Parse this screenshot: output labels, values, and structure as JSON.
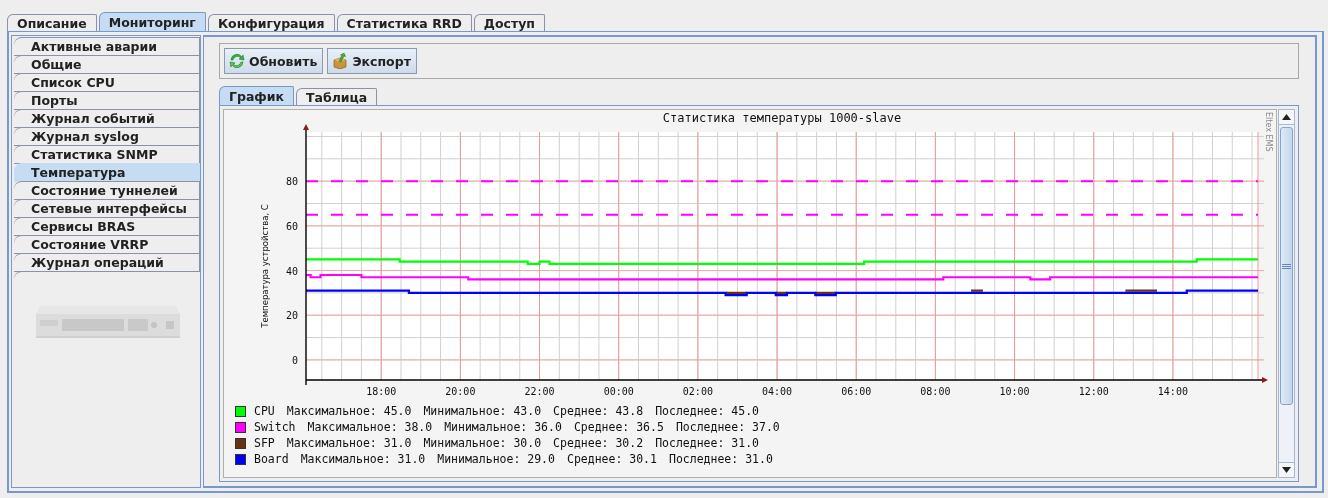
{
  "main_tabs": [
    {
      "label": "Описание",
      "selected": false
    },
    {
      "label": "Мониторинг",
      "selected": true
    },
    {
      "label": "Конфигурация",
      "selected": false
    },
    {
      "label": "Статистика RRD",
      "selected": false
    },
    {
      "label": "Доступ",
      "selected": false
    }
  ],
  "sidebar": {
    "items": [
      {
        "label": "Активные аварии",
        "selected": false
      },
      {
        "label": "Общие",
        "selected": false
      },
      {
        "label": "Список CPU",
        "selected": false
      },
      {
        "label": "Порты",
        "selected": false
      },
      {
        "label": "Журнал событий",
        "selected": false
      },
      {
        "label": "Журнал syslog",
        "selected": false
      },
      {
        "label": "Статистика SNMP",
        "selected": false
      },
      {
        "label": "Температура",
        "selected": true
      },
      {
        "label": "Состояние туннелей",
        "selected": false
      },
      {
        "label": "Сетевые интерфейсы",
        "selected": false
      },
      {
        "label": "Сервисы BRAS",
        "selected": false
      },
      {
        "label": "Состояние VRRP",
        "selected": false
      },
      {
        "label": "Журнал операций",
        "selected": false
      }
    ]
  },
  "toolbar": {
    "buttons": [
      {
        "label": "Обновить",
        "kind": "refresh"
      },
      {
        "label": "Экспорт",
        "kind": "export"
      }
    ]
  },
  "view_tabs": [
    {
      "label": "График",
      "selected": true
    },
    {
      "label": "Таблица",
      "selected": false
    }
  ],
  "chart": {
    "side_text": "Eltex EMS",
    "chart_data": {
      "type": "line",
      "title": "Статистика температуры 1000-slave",
      "ylabel": "Температура устройства, С",
      "grid": true,
      "x": [
        "2000-01-01T16:06",
        "2000-01-01T16:13",
        "2000-01-01T16:13",
        "2000-01-01T16:28",
        "2000-01-01T16:28",
        "2000-01-01T17:30",
        "2000-01-01T17:30",
        "2000-01-01T18:28",
        "2000-01-01T18:28",
        "2000-01-01T18:42",
        "2000-01-01T18:42",
        "2000-01-01T20:12",
        "2000-01-01T20:12",
        "2000-01-01T21:42",
        "2000-01-01T21:42",
        "2000-01-01T22:00",
        "2000-01-01T22:00",
        "2000-01-01T22:15",
        "2000-01-01T22:15",
        "2000-01-02T02:42",
        "2000-01-02T02:42",
        "2000-01-02T03:14",
        "2000-01-02T03:14",
        "2000-01-02T03:58",
        "2000-01-02T03:58",
        "2000-01-02T04:15",
        "2000-01-02T04:15",
        "2000-01-02T04:58",
        "2000-01-02T04:58",
        "2000-01-02T05:29",
        "2000-01-02T05:29",
        "2000-01-02T06:12",
        "2000-01-02T06:12",
        "2000-01-02T08:12",
        "2000-01-02T08:12",
        "2000-01-02T08:54",
        "2000-01-02T08:54",
        "2000-01-02T09:12",
        "2000-01-02T09:12",
        "2000-01-02T10:24",
        "2000-01-02T10:24",
        "2000-01-02T10:54",
        "2000-01-02T10:54",
        "2000-01-02T12:48",
        "2000-01-02T12:48",
        "2000-01-02T13:36",
        "2000-01-02T13:36",
        "2000-01-02T14:21",
        "2000-01-02T14:21",
        "2000-01-02T14:36",
        "2000-01-02T14:36",
        "2000-01-02T16:09"
      ],
      "xlim": [
        "2000-01-01T16:06",
        "2000-01-02T16:09"
      ],
      "ylim": [
        -9,
        102
      ],
      "xticks": [
        {
          "value": "2000-01-01T18:00",
          "label": "18:00"
        },
        {
          "value": "2000-01-01T20:00",
          "label": "20:00"
        },
        {
          "value": "2000-01-01T22:00",
          "label": "22:00"
        },
        {
          "value": "2000-01-02T00:00",
          "label": "00:00"
        },
        {
          "value": "2000-01-02T02:00",
          "label": "02:00"
        },
        {
          "value": "2000-01-02T04:00",
          "label": "04:00"
        },
        {
          "value": "2000-01-02T06:00",
          "label": "06:00"
        },
        {
          "value": "2000-01-02T08:00",
          "label": "08:00"
        },
        {
          "value": "2000-01-02T10:00",
          "label": "10:00"
        },
        {
          "value": "2000-01-02T12:00",
          "label": "12:00"
        },
        {
          "value": "2000-01-02T14:00",
          "label": "14:00"
        }
      ],
      "yticks": [
        0,
        20,
        40,
        60,
        80
      ],
      "ref_lines": [
        {
          "axis": "y",
          "value": 80,
          "color": "#ff00ff"
        },
        {
          "axis": "y",
          "value": 65,
          "color": "#ff00ff"
        }
      ],
      "series": [
        {
          "name": "CPU",
          "color": "#00ff00",
          "values": [
            45,
            45,
            45,
            45,
            45,
            45,
            45,
            45,
            44,
            44,
            44,
            44,
            44,
            44,
            43,
            43,
            44,
            44,
            43,
            43,
            43,
            43,
            43,
            43,
            43,
            43,
            43,
            43,
            43,
            43,
            43,
            43,
            44,
            44,
            44,
            44,
            44,
            44,
            44,
            44,
            44,
            44,
            44,
            44,
            44,
            44,
            44,
            44,
            44,
            44,
            45,
            45
          ]
        },
        {
          "name": "Switch",
          "color": "#ff00ff",
          "values": [
            38,
            38,
            37,
            37,
            38,
            38,
            37,
            37,
            37,
            37,
            37,
            37,
            36,
            36,
            36,
            36,
            36,
            36,
            36,
            36,
            36,
            36,
            36,
            36,
            36,
            36,
            36,
            36,
            36,
            36,
            36,
            36,
            36,
            36,
            37,
            37,
            37,
            37,
            37,
            37,
            36,
            36,
            37,
            37,
            37,
            37,
            37,
            37,
            37,
            37,
            37,
            37
          ]
        },
        {
          "name": "SFP",
          "color": "#663311",
          "values": [
            null,
            null,
            null,
            null,
            null,
            null,
            null,
            null,
            null,
            null,
            null,
            null,
            null,
            null,
            null,
            null,
            null,
            null,
            null,
            null,
            30,
            30,
            null,
            null,
            30,
            30,
            null,
            null,
            30,
            30,
            null,
            null,
            null,
            null,
            null,
            null,
            31,
            31,
            null,
            null,
            null,
            null,
            null,
            null,
            31,
            31,
            null,
            null,
            null,
            null,
            null,
            null
          ]
        },
        {
          "name": "Board",
          "color": "#0000ff",
          "values": [
            31,
            31,
            31,
            31,
            31,
            31,
            31,
            31,
            31,
            31,
            30,
            30,
            30,
            30,
            30,
            30,
            30,
            30,
            30,
            30,
            29,
            29,
            30,
            30,
            29,
            29,
            30,
            30,
            29,
            29,
            30,
            30,
            30,
            30,
            30,
            30,
            30,
            30,
            30,
            30,
            30,
            30,
            30,
            30,
            30,
            30,
            30,
            30,
            31,
            31,
            31,
            31
          ]
        }
      ]
    },
    "legend": [
      {
        "stats": [
          {
            "label": "Максимальное:",
            "value": "45.0"
          },
          {
            "label": "Минимальное:",
            "value": "43.0"
          },
          {
            "label": "Среднее:",
            "value": "43.8"
          },
          {
            "label": "Последнее:",
            "value": "45.0"
          }
        ]
      },
      {
        "stats": [
          {
            "label": "Максимальное:",
            "value": "38.0"
          },
          {
            "label": "Минимальное:",
            "value": "36.0"
          },
          {
            "label": "Среднее:",
            "value": "36.5"
          },
          {
            "label": "Последнее:",
            "value": "37.0"
          }
        ]
      },
      {
        "stats": [
          {
            "label": "Максимальное:",
            "value": "31.0"
          },
          {
            "label": "Минимальное:",
            "value": "30.0"
          },
          {
            "label": "Среднее:",
            "value": "30.2"
          },
          {
            "label": "Последнее:",
            "value": "31.0"
          }
        ]
      },
      {
        "stats": [
          {
            "label": "Максимальное:",
            "value": "31.0"
          },
          {
            "label": "Минимальное:",
            "value": "29.0"
          },
          {
            "label": "Среднее:",
            "value": "30.1"
          },
          {
            "label": "Последнее:",
            "value": "31.0"
          }
        ]
      }
    ]
  }
}
